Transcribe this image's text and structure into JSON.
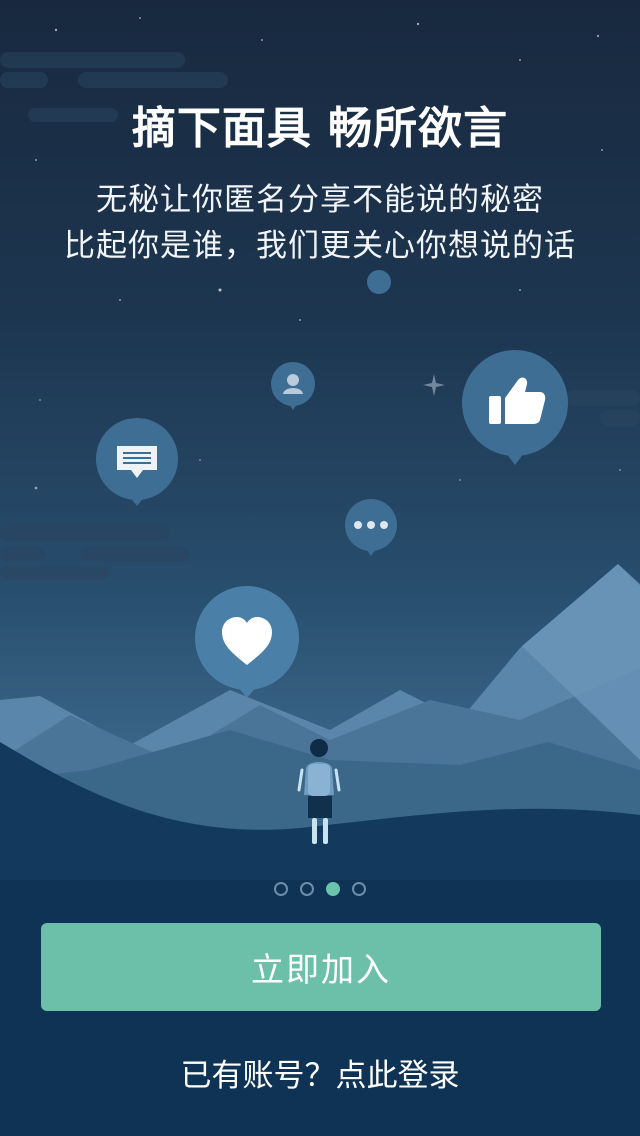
{
  "header": {
    "title": "摘下面具 畅所欲言",
    "subtitle_line1": "无秘让你匿名分享不能说的秘密",
    "subtitle_line2": "比起你是谁，我们更关心你想说的话"
  },
  "pager": {
    "total": 4,
    "active_index": 2
  },
  "actions": {
    "join_label": "立即加入",
    "login_label": "已有账号？点此登录"
  },
  "colors": {
    "accent": "#6cc0aa",
    "bubble": "#3f6e95",
    "night_top": "#18293f",
    "night_bottom": "#0d2b48"
  },
  "icons": [
    "thumbs-up-icon",
    "message-icon",
    "user-icon",
    "more-icon",
    "heart-icon",
    "person-illustration"
  ]
}
